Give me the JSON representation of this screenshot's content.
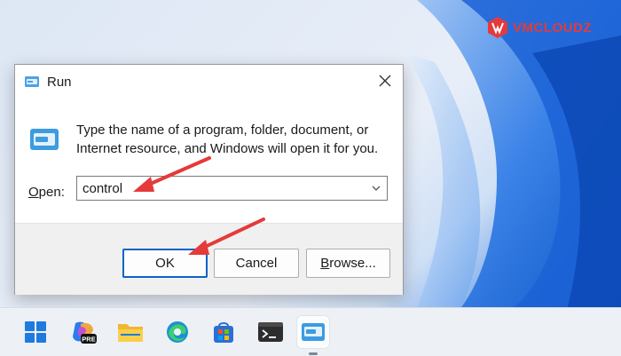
{
  "brand": {
    "text": "VMCLOUDZ",
    "color": "#e33b3b"
  },
  "dialog": {
    "title": "Run",
    "description": "Type the name of a program, folder, document, or Internet resource, and Windows will open it for you.",
    "open_label_prefix": "O",
    "open_label_rest": "pen:",
    "input_value": "control",
    "buttons": {
      "ok": "OK",
      "cancel": "Cancel",
      "browse_prefix": "B",
      "browse_rest": "rowse..."
    },
    "accent": "#0a63c9"
  },
  "annotations": {
    "arrow_color": "#e53a3a"
  },
  "taskbar": {
    "icons": [
      "windows-start-icon",
      "copilot-pre-icon",
      "file-explorer-icon",
      "edge-icon",
      "microsoft-store-icon",
      "terminal-icon",
      "run-icon"
    ],
    "copilot_badge": "PRE"
  }
}
